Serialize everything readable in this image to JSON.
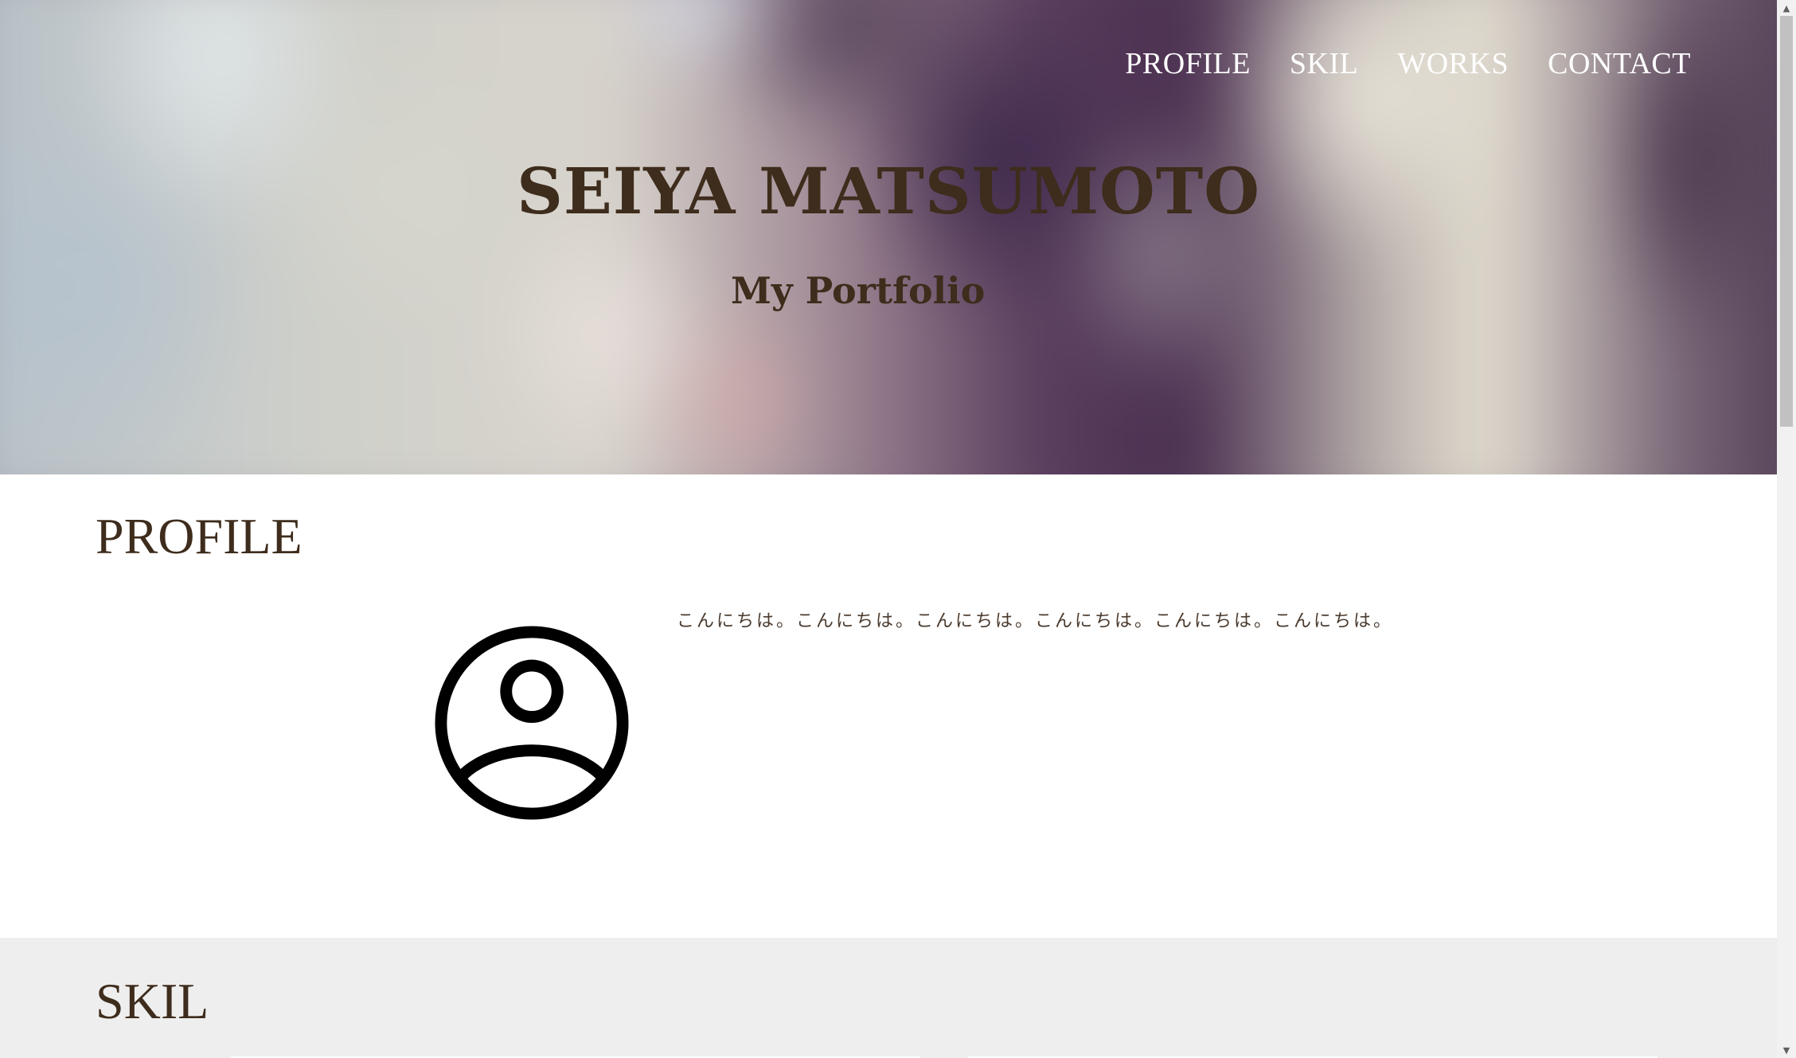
{
  "nav": {
    "items": [
      {
        "label": "PROFILE"
      },
      {
        "label": "SKIL"
      },
      {
        "label": "WORKS"
      },
      {
        "label": "CONTACT"
      }
    ]
  },
  "hero": {
    "title": "SEIYA MATSUMOTO",
    "subtitle": "My Portfolio"
  },
  "profile": {
    "heading": "PROFILE",
    "avatar_icon": "user-circle-icon",
    "text": "こんにちは。こんにちは。こんにちは。こんにちは。こんにちは。こんにちは。"
  },
  "skil": {
    "heading": "SKIL"
  },
  "colors": {
    "heading_text": "#3e2c1c",
    "nav_text": "#ffffff",
    "skil_background": "#eeeeee"
  }
}
